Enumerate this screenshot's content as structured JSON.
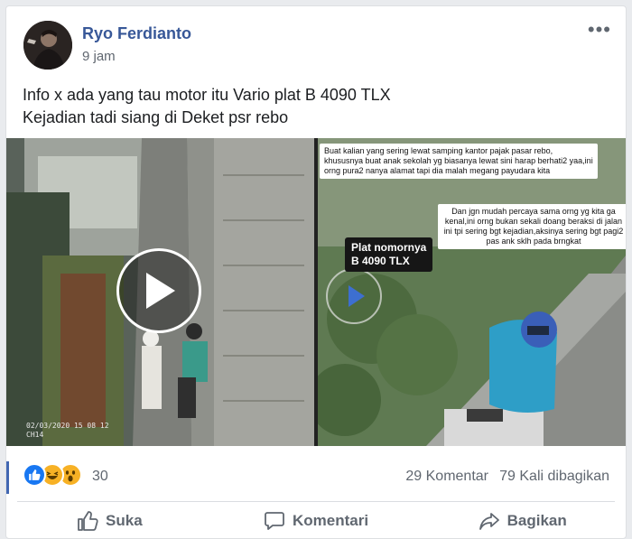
{
  "post": {
    "author": "Ryo Ferdianto",
    "time": "9 jam",
    "more_label": "•••",
    "text_line1": "Info x ada yang tau motor itu Vario plat B 4090 TLX",
    "text_line2": "Kejadian tadi siang di Deket psr rebo"
  },
  "media": {
    "cctv_timestamp": "02/03/2020 15 08 12",
    "cctv_channel": "CH14",
    "note_top": "Buat kalian yang sering lewat samping kantor pajak pasar rebo, khususnya buat anak sekolah yg biasanya lewat sini harap berhati2 yaa,ini orng pura2 nanya alamat tapi dia malah megang payudara kita",
    "note_middle": "Dan jgn mudah percaya sama orng yg kita ga kenal,ini orng bukan sekali doang beraksi di jalan ini tpi sering bgt kejadian,aksinya sering bgt pagi2 pas ank sklh pada brngkat",
    "plate_label_line1": "Plat nomornya",
    "plate_label_line2": "B 4090 TLX"
  },
  "stats": {
    "reaction_count": "30",
    "comments": "29 Komentar",
    "shares": "79 Kali dibagikan"
  },
  "actions": {
    "like": "Suka",
    "comment": "Komentari",
    "share": "Bagikan"
  },
  "colors": {
    "author_link": "#385898",
    "like_blue": "#1877f2",
    "haha_yellow": "#f7b125",
    "secondary_text": "#606770"
  },
  "icons": {
    "like_reaction": "like-reaction-icon",
    "haha_reaction": "haha-reaction-icon",
    "wow_reaction": "wow-reaction-icon",
    "play": "play-icon",
    "thumb": "thumbs-up-icon",
    "comment": "comment-icon",
    "share": "share-icon"
  }
}
